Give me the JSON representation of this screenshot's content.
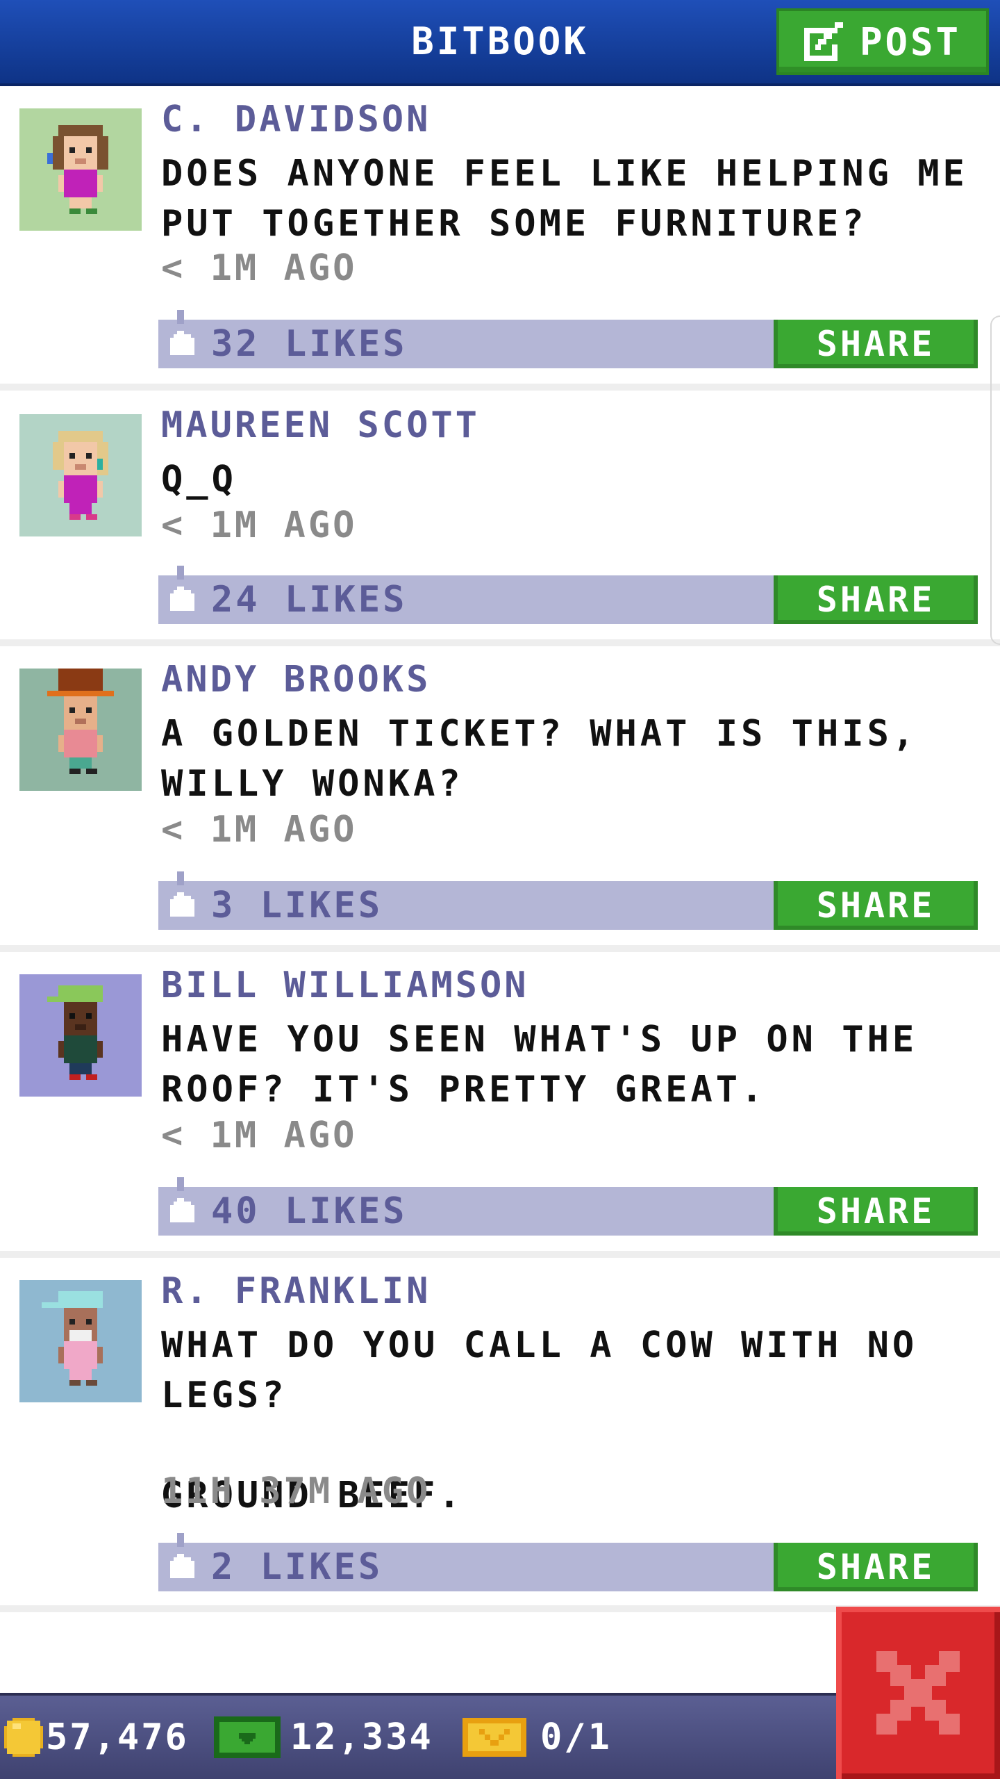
{
  "header": {
    "title": "BITBOOK",
    "post_label": "POST"
  },
  "posts": [
    {
      "author": "C. DAVIDSON",
      "message": "DOES ANYONE FEEL LIKE HELPING ME PUT TOGETHER SOME FURNITURE?",
      "time": "< 1M AGO",
      "likes": "32 LIKES",
      "share": "SHARE"
    },
    {
      "author": "MAUREEN SCOTT",
      "message": "Q_Q",
      "time": "< 1M AGO",
      "likes": "24 LIKES",
      "share": "SHARE"
    },
    {
      "author": "ANDY BROOKS",
      "message": "A GOLDEN TICKET? WHAT IS THIS, WILLY WONKA?",
      "time": "< 1M AGO",
      "likes": "3 LIKES",
      "share": "SHARE"
    },
    {
      "author": "BILL WILLIAMSON",
      "message": "HAVE YOU SEEN WHAT'S UP ON THE ROOF? IT'S PRETTY GREAT.",
      "time": "< 1M AGO",
      "likes": "40 LIKES",
      "share": "SHARE"
    },
    {
      "author": "R. FRANKLIN",
      "message": "WHAT DO YOU CALL A COW WITH NO LEGS?\n\nGROUND BEEF.",
      "time": "11H 37M AGO",
      "likes": "2 LIKES",
      "share": "SHARE"
    }
  ],
  "status_bar": {
    "coins": "57,476",
    "bux": "12,334",
    "tickets": "0/1"
  },
  "icons": {
    "post": "edit-icon",
    "like": "thumbs-up-icon",
    "coins": "coin-icon",
    "bux": "bux-icon",
    "tickets": "ticket-icon",
    "close": "close-icon"
  },
  "colors": {
    "header": "#1f4fb8",
    "accent_green": "#3aa832",
    "like_bar": "#b4b6d6",
    "author": "#5c5c98",
    "close": "#d9282b"
  }
}
